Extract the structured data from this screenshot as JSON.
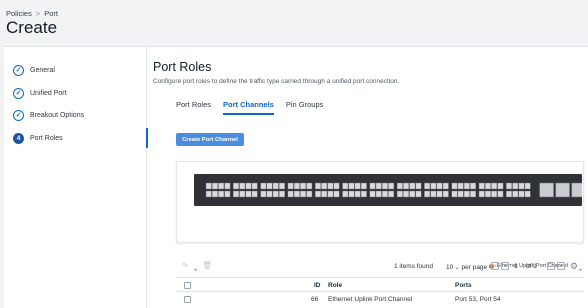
{
  "breadcrumb": {
    "items": [
      "Policies",
      "Port"
    ],
    "separator": ">"
  },
  "page_title": "Create",
  "steps": [
    {
      "label": "General",
      "state": "done",
      "marker": "✓"
    },
    {
      "label": "Unified Port",
      "state": "done",
      "marker": "✓"
    },
    {
      "label": "Breakout Options",
      "state": "done",
      "marker": "✓"
    },
    {
      "label": "Port Roles",
      "state": "active",
      "marker": "4"
    }
  ],
  "section": {
    "title": "Port Roles",
    "description": "Configure port roles to define the traffic type carried through a unified port connection."
  },
  "tabs": [
    {
      "label": "Port Roles",
      "active": false
    },
    {
      "label": "Port Channels",
      "active": true
    },
    {
      "label": "Pin Groups",
      "active": false
    }
  ],
  "create_button": "Create Port Channel",
  "switch": {
    "legend_label": "Ethernet Uplink Port Channel",
    "legend_color": "#b57f5b"
  },
  "toolbar": {
    "items_found": "1 items found",
    "per_page_value": "10",
    "per_page_label": "per page",
    "page": "1",
    "of_pages": "of 1"
  },
  "table": {
    "columns": [
      "ID",
      "Role",
      "Ports"
    ],
    "rows": [
      {
        "id": "66",
        "role": "Ethernet Uplink Port Channel",
        "ports": "Port 53, Port 54"
      }
    ]
  },
  "colors": {
    "accent": "#0d68c9",
    "button": "#4c8de0"
  }
}
